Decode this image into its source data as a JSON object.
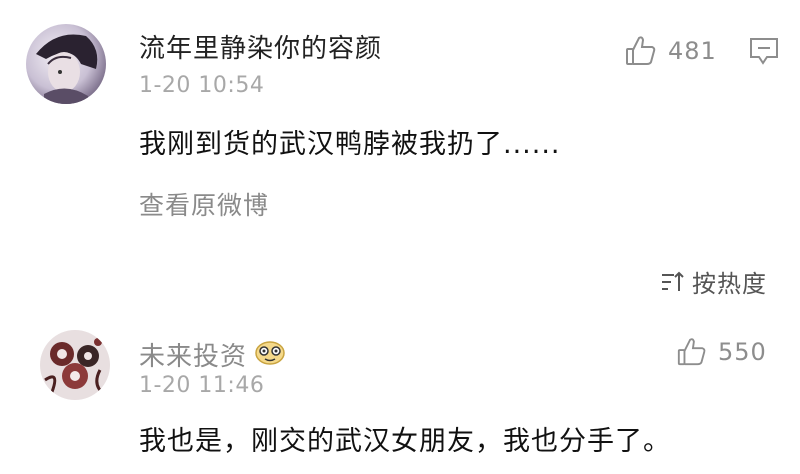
{
  "comments": [
    {
      "username": "流年里静染你的容颜",
      "timestamp": "1-20 10:54",
      "text": "我刚到货的武汉鸭脖被我扔了......",
      "likes": "481",
      "username_color": "#222222"
    },
    {
      "username": "未来投资",
      "timestamp": "1-20 11:46",
      "text": "我也是，刚交的武汉女朋友，我也分手了。",
      "likes": "550",
      "username_color": "#8a8a8a"
    }
  ],
  "view_original_label": "查看原微博",
  "sort_label": "按热度",
  "colors": {
    "secondary_text": "#8a8a8a",
    "timestamp": "#a8a8a8",
    "icon": "#8d8d8d"
  }
}
